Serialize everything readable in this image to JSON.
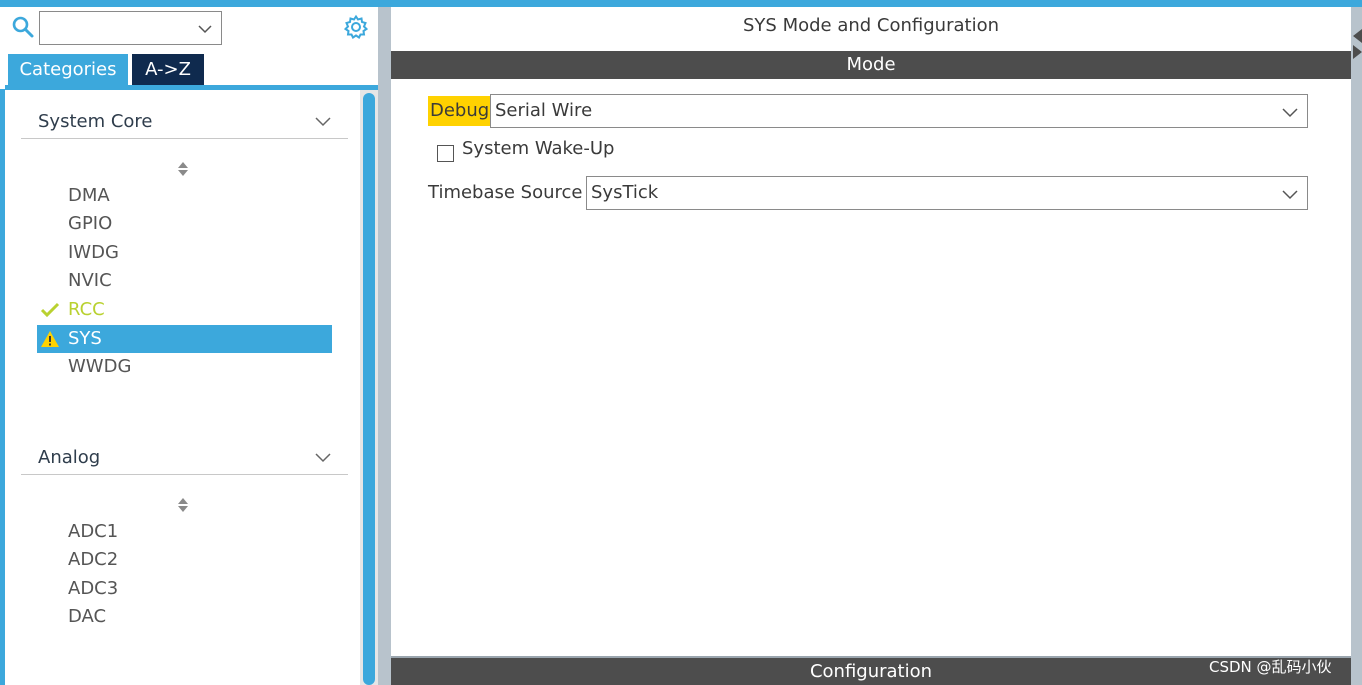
{
  "search": {
    "value": ""
  },
  "tabs": [
    {
      "label": "Categories",
      "active": true
    },
    {
      "label": "A->Z",
      "active": false
    }
  ],
  "categories": [
    {
      "name": "System Core",
      "items": [
        {
          "label": "DMA",
          "status": "none"
        },
        {
          "label": "GPIO",
          "status": "none"
        },
        {
          "label": "IWDG",
          "status": "none"
        },
        {
          "label": "NVIC",
          "status": "none"
        },
        {
          "label": "RCC",
          "status": "ok"
        },
        {
          "label": "SYS",
          "status": "warning",
          "selected": true
        },
        {
          "label": "WWDG",
          "status": "none"
        }
      ]
    },
    {
      "name": "Analog",
      "items": [
        {
          "label": "ADC1",
          "status": "none"
        },
        {
          "label": "ADC2",
          "status": "none"
        },
        {
          "label": "ADC3",
          "status": "none"
        },
        {
          "label": "DAC",
          "status": "none"
        }
      ]
    }
  ],
  "main": {
    "title": "SYS Mode and Configuration",
    "mode_header": "Mode",
    "debug": {
      "label": "Debug",
      "value": "Serial Wire"
    },
    "wakeup": {
      "label": "System Wake-Up",
      "checked": false
    },
    "timebase": {
      "label": "Timebase Source",
      "value": "SysTick"
    },
    "config_header": "Configuration"
  },
  "watermark": "CSDN @乱码小伙",
  "colors": {
    "accent": "#3ca8dc",
    "dark_tab": "#0f2a4e",
    "header_bar": "#4d4d4d",
    "ok": "#b9d130",
    "warning": "#ffd200",
    "highlight": "#ffd200"
  },
  "icons": {
    "search": "search-icon",
    "settings": "gear-icon",
    "dropdown": "chevron-down-icon",
    "sort": "sort-icon",
    "ok": "check-icon",
    "warning": "warning-icon",
    "collapse": "collapse-arrow-icon"
  }
}
